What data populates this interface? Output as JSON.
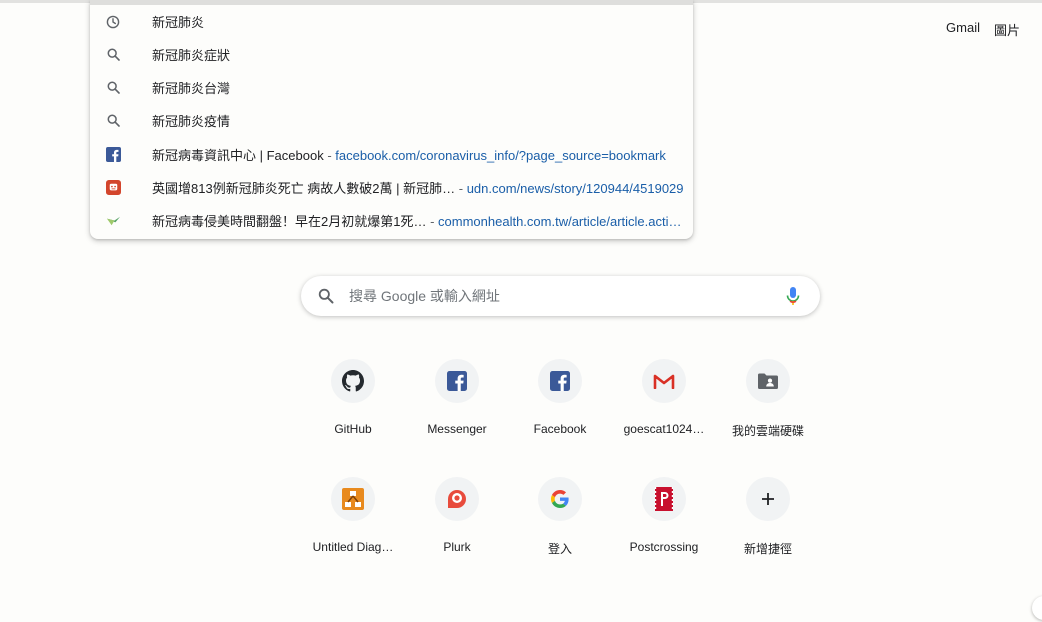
{
  "top_links": {
    "gmail": "Gmail",
    "images": "圖片"
  },
  "suggestions": [
    {
      "icon": "history-icon",
      "text": "新冠肺炎"
    },
    {
      "icon": "search-icon",
      "text": "新冠肺炎症狀"
    },
    {
      "icon": "search-icon",
      "text": "新冠肺炎台灣"
    },
    {
      "icon": "search-icon",
      "text": "新冠肺炎疫情"
    },
    {
      "icon": "facebook-icon",
      "text": "新冠病毒資訊中心 | Facebook",
      "sep": " - ",
      "url": "facebook.com/coronavirus_info/?page_source=bookmark"
    },
    {
      "icon": "udn-icon",
      "text": "英國增813例新冠肺炎死亡 病故人數破2萬 | 新冠肺…",
      "sep": " - ",
      "url": "udn.com/news/story/120944/4519029"
    },
    {
      "icon": "commonhealth-icon",
      "text": "新冠病毒侵美時間翻盤！早在2月初就爆第1死…",
      "sep": " - ",
      "url": "commonhealth.com.tw/article/article.acti…"
    }
  ],
  "search": {
    "placeholder": "搜尋 Google 或輸入網址",
    "value": ""
  },
  "shortcuts": [
    {
      "label": "GitHub",
      "icon": "github-icon"
    },
    {
      "label": "Messenger",
      "icon": "facebook-icon"
    },
    {
      "label": "Facebook",
      "icon": "facebook-icon"
    },
    {
      "label": "goescat1024…",
      "icon": "gmail-icon"
    },
    {
      "label": "我的雲端硬碟",
      "icon": "google-drive-icon"
    },
    {
      "label": "Untitled Diag…",
      "icon": "drawio-icon"
    },
    {
      "label": "Plurk",
      "icon": "plurk-icon"
    },
    {
      "label": "登入",
      "icon": "google-icon"
    },
    {
      "label": "Postcrossing",
      "icon": "postcrossing-icon"
    },
    {
      "label": "新增捷徑",
      "icon": "plus-icon"
    }
  ],
  "colors": {
    "url": "#1a5ea8",
    "facebook": "#3b5998",
    "gmail_red": "#d93025",
    "udn": "#d3452c",
    "postcrossing": "#c8102e"
  }
}
